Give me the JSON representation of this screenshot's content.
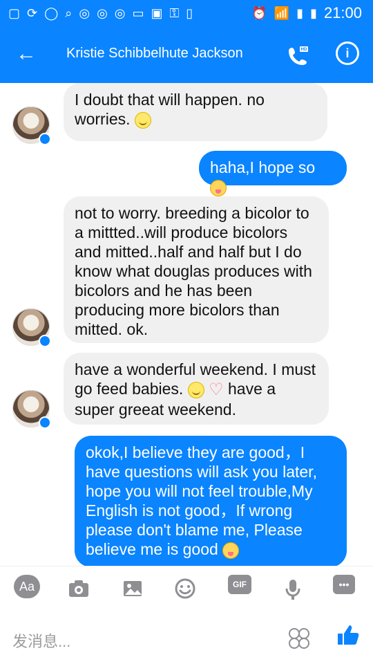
{
  "status_bar": {
    "time": "21:00",
    "left_icons": [
      "sim-icon",
      "sync-icon",
      "circle-icon",
      "search-icon",
      "weibo-icon",
      "weibo-icon",
      "weibo-icon",
      "battery-small-icon",
      "image-icon",
      "key-icon",
      "phone-icon"
    ],
    "right_icons": [
      "alarm-icon",
      "wifi-icon",
      "signal-icon",
      "battery-icon"
    ]
  },
  "header": {
    "title": "Kristie Schibbelhute Jackson"
  },
  "messages": [
    {
      "side": "left",
      "text": "I doubt that will happen. no worries.",
      "emoji": "smile"
    },
    {
      "side": "right",
      "text": "haha,I hope so",
      "emoji": "tongue"
    },
    {
      "side": "left",
      "text": "not to worry. breeding a bicolor to a mittted..will produce bicolors and mitted..half and half but I do know what douglas produces with bicolors and he has been producing more bicolors than mitted. ok.",
      "emoji": ""
    },
    {
      "side": "left",
      "text": "have a wonderful weekend. I must go feed babies.",
      "text2": "have a super greeat weekend.",
      "emoji": "smile-heart"
    },
    {
      "side": "right",
      "text": "okok,I believe they are good，I have questions will ask you later, hope you will not feel trouble,My English is not good，If wrong please don't blame me, Please believe me is good",
      "emoji": "tongue"
    }
  ],
  "toolbar": {
    "aa_label": "Aa",
    "gif_label": "GIF",
    "more_label": "•••"
  },
  "composer": {
    "placeholder": "发消息..."
  },
  "colors": {
    "accent": "#0a84ff",
    "bubble_left": "#f1f0f0",
    "bubble_right": "#0a84ff",
    "text_dark": "#111111",
    "icon_gray": "#8e8e93"
  }
}
